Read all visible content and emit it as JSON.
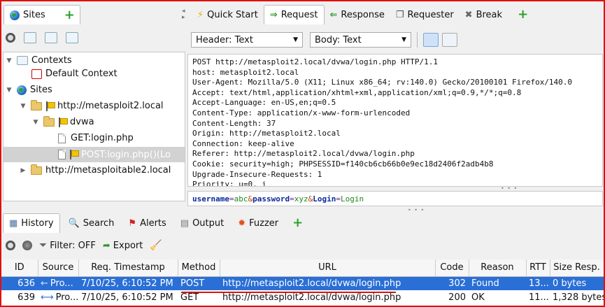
{
  "top": {
    "sites_tab": "Sites",
    "work_tabs": [
      {
        "label": "Quick Start",
        "icon": "lightning-icon"
      },
      {
        "label": "Request",
        "icon": "arrow-right-icon"
      },
      {
        "label": "Response",
        "icon": "arrow-left-icon"
      },
      {
        "label": "Requester",
        "icon": "requester-icon"
      },
      {
        "label": "Break",
        "icon": "tools-icon"
      }
    ]
  },
  "tree": {
    "contexts": "Contexts",
    "default_context": "Default Context",
    "sites": "Sites",
    "host1": "http://metasploit2.local",
    "dvwa": "dvwa",
    "get_login": "GET:login.php",
    "post_login": "POST:login.php()(Lo",
    "host2": "http://metasploitable2.local"
  },
  "request": {
    "header_select": "Header: Text",
    "body_select": "Body: Text",
    "header_lines": [
      "POST http://metasploit2.local/dvwa/login.php HTTP/1.1",
      "host: metasploit2.local",
      "User-Agent: Mozilla/5.0 (X11; Linux x86_64; rv:140.0) Gecko/20100101 Firefox/140.0",
      "Accept: text/html,application/xhtml+xml,application/xml;q=0.9,*/*;q=0.8",
      "Accept-Language: en-US,en;q=0.5",
      "Content-Type: application/x-www-form-urlencoded",
      "Content-Length: 37",
      "Origin: http://metasploit2.local",
      "Connection: keep-alive",
      "Referer: http://metasploit2.local/dvwa/login.php",
      "Cookie: security=high; PHPSESSID=f140cb6cb66b0e9ec18d2406f2adb4b8",
      "Upgrade-Insecure-Requests: 1",
      "Priority: u=0, i"
    ],
    "body": [
      {
        "t": "username",
        "c": "#0a2a9a",
        "b": true
      },
      {
        "t": "=",
        "c": "#7a1aa0",
        "b": false
      },
      {
        "t": "abc",
        "c": "#1a8a1a",
        "b": false
      },
      {
        "t": "&",
        "c": "#c04000",
        "b": false
      },
      {
        "t": "password",
        "c": "#0a2a9a",
        "b": true
      },
      {
        "t": "=",
        "c": "#7a1aa0",
        "b": false
      },
      {
        "t": "xyz",
        "c": "#1a8a1a",
        "b": false
      },
      {
        "t": "&",
        "c": "#c04000",
        "b": false
      },
      {
        "t": "Login",
        "c": "#0a2a9a",
        "b": true
      },
      {
        "t": "=",
        "c": "#7a1aa0",
        "b": false
      },
      {
        "t": "Login",
        "c": "#1a8a1a",
        "b": false
      }
    ]
  },
  "bottom": {
    "tabs": [
      {
        "label": "History",
        "icon": "history-icon"
      },
      {
        "label": "Search",
        "icon": "search-icon"
      },
      {
        "label": "Alerts",
        "icon": "alerts-flag-icon"
      },
      {
        "label": "Output",
        "icon": "output-icon"
      },
      {
        "label": "Fuzzer",
        "icon": "fuzzer-icon"
      }
    ],
    "filter": "Filter: OFF",
    "export": "Export"
  },
  "history": {
    "columns": [
      "ID",
      "Source",
      "Req. Timestamp",
      "Method",
      "URL",
      "Code",
      "Reason",
      "RTT",
      "Size Resp."
    ],
    "rows": [
      {
        "id": "636",
        "source": "Pro...",
        "ts": "7/10/25, 6:10:52 PM",
        "method": "POST",
        "url": "http://metasploit2.local/dvwa/login.php",
        "code": "302",
        "reason": "Found",
        "rtt": "13...",
        "size": "0 bytes",
        "dir": "←",
        "selected": true
      },
      {
        "id": "639",
        "source": "Pro...",
        "ts": "7/10/25, 6:10:52 PM",
        "method": "GET",
        "url": "http://metasploit2.local/dvwa/login.php",
        "code": "200",
        "reason": "OK",
        "rtt": "11...",
        "size": "1,328 bytes",
        "dir": "⟷",
        "selected": false
      }
    ]
  },
  "colors": {
    "selection": "#2a6fd6",
    "frame": "#e01010",
    "underline": "#e01010"
  }
}
